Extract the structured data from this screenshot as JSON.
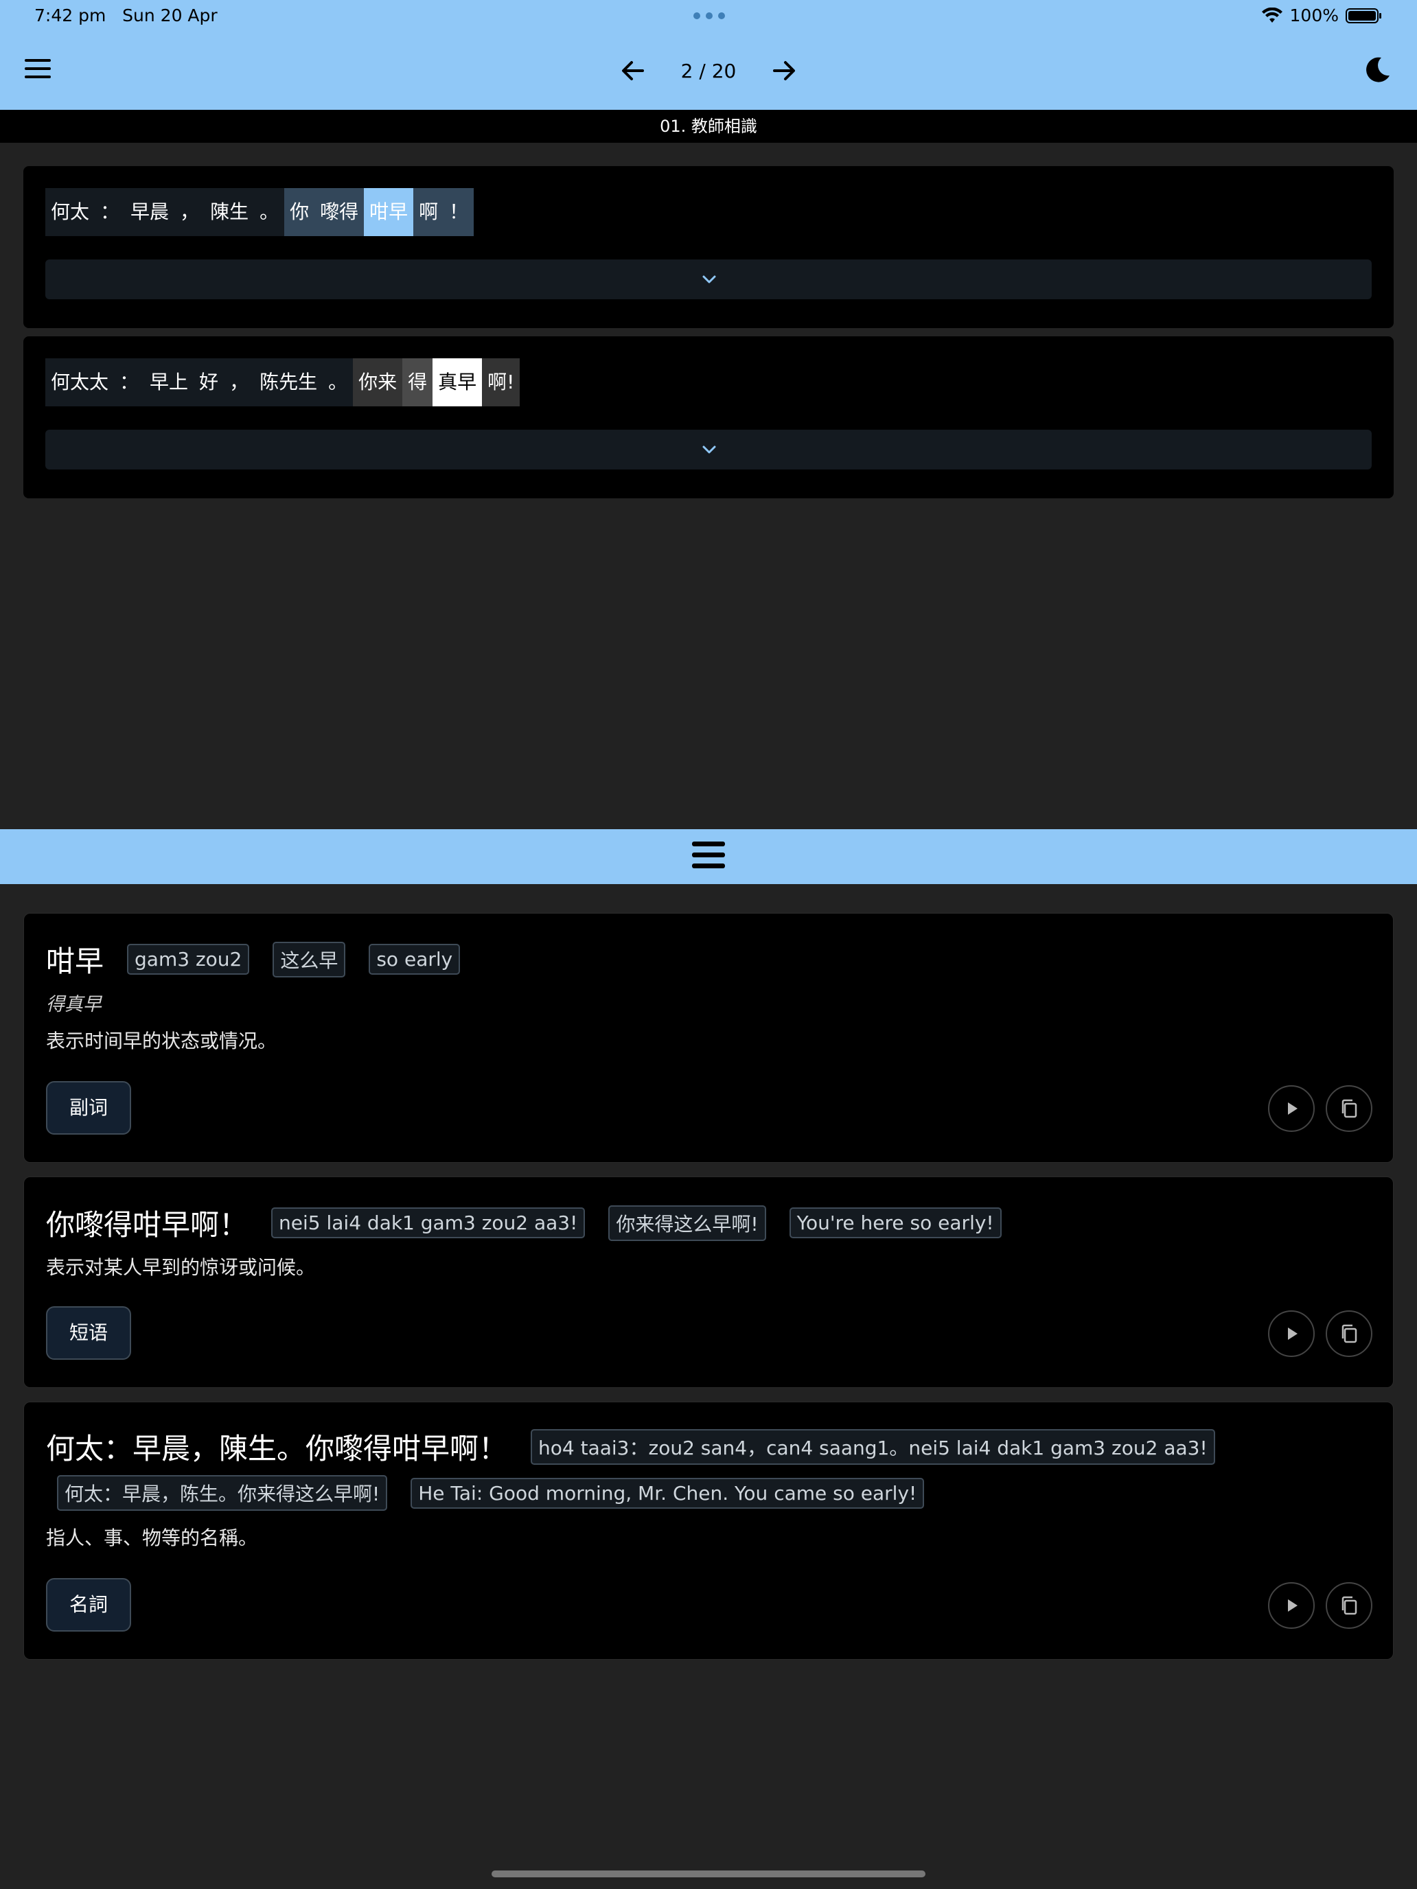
{
  "status": {
    "time": "7:42 pm",
    "date": "Sun 20 Apr",
    "battery": "100%"
  },
  "nav": {
    "page": "2 / 20"
  },
  "lesson": {
    "title": "01. 教師相識"
  },
  "sentences": [
    {
      "tokens": [
        {
          "text": "何太",
          "bg": "#141a20"
        },
        {
          "text": "：",
          "bg": "#141a20"
        },
        {
          "text": "早晨",
          "bg": "#141a20"
        },
        {
          "text": "，",
          "bg": "#141a20"
        },
        {
          "text": "陳生",
          "bg": "#141a20"
        },
        {
          "text": "。",
          "bg": "#141a20"
        },
        {
          "text": "你",
          "bg": "#33475a"
        },
        {
          "text": "嚟得",
          "bg": "#33475a"
        },
        {
          "text": "咁早",
          "bg": "#90c8f7"
        },
        {
          "text": "啊",
          "bg": "#33475a"
        },
        {
          "text": "！",
          "bg": "#33475a"
        }
      ]
    },
    {
      "tokens": [
        {
          "text": "何太太",
          "bg": "#141a20"
        },
        {
          "text": "：",
          "bg": "#141a20"
        },
        {
          "text": "早上",
          "bg": "#141a20"
        },
        {
          "text": "好",
          "bg": "#141a20"
        },
        {
          "text": "，",
          "bg": "#141a20"
        },
        {
          "text": "陈先生",
          "bg": "#141a20"
        },
        {
          "text": "。",
          "bg": "#141a20"
        },
        {
          "text": "你来",
          "bg": "#333333"
        },
        {
          "text": "得",
          "bg": "#4a4a4a"
        },
        {
          "text": "真早",
          "bg": "#ffffff",
          "fg": "#000000"
        },
        {
          "text": "啊!",
          "bg": "#333333"
        }
      ]
    }
  ],
  "entries": [
    {
      "title": "咁早",
      "chips": [
        "gam3 zou2",
        "这么早",
        "so early"
      ],
      "alt": "得真早",
      "desc": "表示时间早的状态或情况。",
      "pos": "副词"
    },
    {
      "title": "你嚟得咁早啊！",
      "chips": [
        "nei5 lai4 dak1 gam3 zou2 aa3!",
        "你来得这么早啊!",
        "You're here so early!"
      ],
      "desc": "表示对某人早到的惊讶或问候。",
      "pos": "短语"
    },
    {
      "title": "何太：早晨，陳生。你嚟得咁早啊！",
      "chips": [
        "ho4 taai3：zou2 san4，can4 saang1。nei5 lai4 dak1 gam3 zou2 aa3!",
        "何太：早晨，陈生。你来得这么早啊!",
        "He Tai: Good morning, Mr. Chen. You came so early!"
      ],
      "desc": "指人、事、物等的名稱。",
      "pos": "名詞"
    }
  ]
}
